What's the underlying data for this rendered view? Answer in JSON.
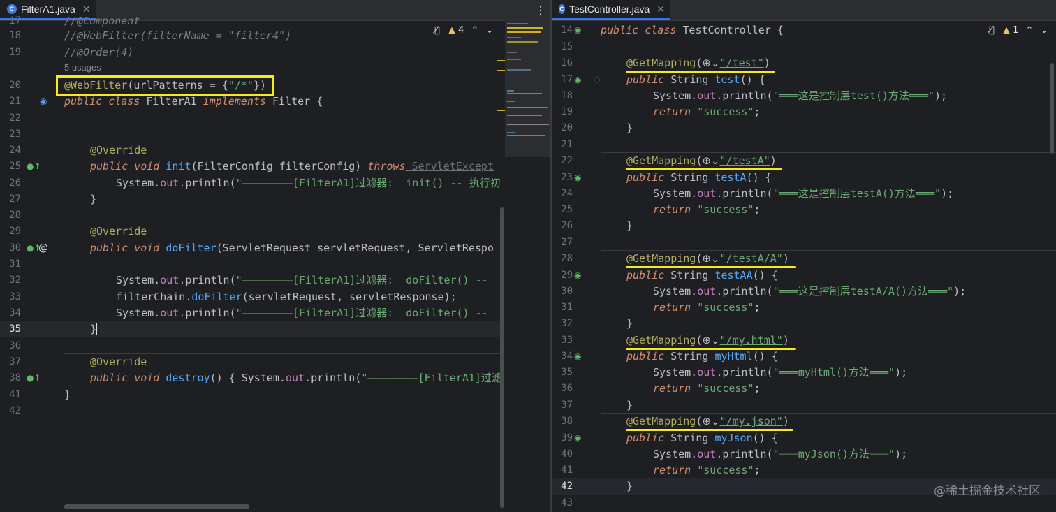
{
  "left": {
    "tab_label": "FilterA1.java",
    "inspection_count": "4",
    "lines": {
      "l17": {
        "num": "17",
        "text": "//@Component"
      },
      "l18": {
        "num": "18",
        "text": "//@WebFilter(filterName = \"filter4\")"
      },
      "l19": {
        "num": "19",
        "text": "//@Order(4)"
      },
      "usages": "5 usages",
      "l20": {
        "num": "20",
        "ann": "@WebFilter",
        "rest": "(urlPatterns = {",
        "str": "\"/*\"",
        "end": "})"
      },
      "l21": {
        "num": "21",
        "kw1": "public",
        "kw2": "class",
        "name": " FilterA1 ",
        "kw3": "implements",
        "rest": " Filter {"
      },
      "l22": {
        "num": "22"
      },
      "l23": {
        "num": "23"
      },
      "l24": {
        "num": "24",
        "ann": "@Override"
      },
      "l25": {
        "num": "25",
        "kw1": "public",
        "kw2": "void",
        "fn": "init",
        "rest": "(FilterConfig filterConfig) ",
        "kw3": "throws",
        "dep": " ServletExcept"
      },
      "l26": {
        "num": "26",
        "pre": "System.",
        "fld": "out",
        "mid": ".println(",
        "str": "\"————————[FilterA1]过滤器:  init() -- 执行初"
      },
      "l27": {
        "num": "27",
        "text": "}"
      },
      "l28": {
        "num": "28"
      },
      "l29": {
        "num": "29",
        "ann": "@Override"
      },
      "l30": {
        "num": "30",
        "kw1": "public",
        "kw2": "void",
        "fn": "doFilter",
        "rest": "(ServletRequest servletRequest, ServletRespo"
      },
      "l31": {
        "num": "31"
      },
      "l32": {
        "num": "32",
        "pre": "System.",
        "fld": "out",
        "mid": ".println(",
        "str": "\"————————[FilterA1]过滤器:  doFilter() --"
      },
      "l33": {
        "num": "33",
        "pre": "filterChain.",
        "fn": "doFilter",
        "rest": "(servletRequest, servletResponse);"
      },
      "l34": {
        "num": "34",
        "pre": "System.",
        "fld": "out",
        "mid": ".println(",
        "str": "\"————————[FilterA1]过滤器:  doFilter() --"
      },
      "l35": {
        "num": "35",
        "text": "}"
      },
      "l36": {
        "num": "36"
      },
      "l37": {
        "num": "37",
        "ann": "@Override"
      },
      "l38": {
        "num": "38",
        "kw1": "public",
        "kw2": "void",
        "fn": "destroy",
        "rest": "() { System.",
        "fld": "out",
        "mid": ".println(",
        "str": "\"————————[FilterA1]过滤"
      },
      "l41": {
        "num": "41",
        "text": "}"
      },
      "l42": {
        "num": "42"
      }
    }
  },
  "right": {
    "tab_label": "TestController.java",
    "inspection_count": "1",
    "watermark": "@稀土掘金技术社区",
    "lines": {
      "l14": {
        "num": "14",
        "kw1": "public",
        "kw2": "class",
        "rest": " TestController {"
      },
      "l15": {
        "num": "15"
      },
      "l16": {
        "num": "16",
        "ann": "@GetMapping",
        "open": "(",
        "path": "\"/test\"",
        "close": ")"
      },
      "l17": {
        "num": "17",
        "kw1": "public",
        "rest": " String ",
        "fn": "test",
        "end": "() {"
      },
      "l18": {
        "num": "18",
        "pre": "System.",
        "fld": "out",
        "mid": ".println(",
        "str": "\"═══这是控制层test()方法═══\"",
        "end": ");"
      },
      "l19": {
        "num": "19",
        "kw": "return",
        "str": " \"success\"",
        "end": ";"
      },
      "l20": {
        "num": "20",
        "text": "}"
      },
      "l21": {
        "num": "21"
      },
      "l22": {
        "num": "22",
        "ann": "@GetMapping",
        "open": "(",
        "path": "\"/testA\"",
        "close": ")"
      },
      "l23": {
        "num": "23",
        "kw1": "public",
        "rest": " String ",
        "fn": "testA",
        "end": "() {"
      },
      "l24": {
        "num": "24",
        "pre": "System.",
        "fld": "out",
        "mid": ".println(",
        "str": "\"═══这是控制层testA()方法═══\"",
        "end": ");"
      },
      "l25": {
        "num": "25",
        "kw": "return",
        "str": " \"success\"",
        "end": ";"
      },
      "l26": {
        "num": "26",
        "text": "}"
      },
      "l27": {
        "num": "27"
      },
      "l28": {
        "num": "28",
        "ann": "@GetMapping",
        "open": "(",
        "path": "\"/testA/A\"",
        "close": ")"
      },
      "l29": {
        "num": "29",
        "kw1": "public",
        "rest": " String ",
        "fn": "testAA",
        "end": "() {"
      },
      "l30": {
        "num": "30",
        "pre": "System.",
        "fld": "out",
        "mid": ".println(",
        "str": "\"═══这是控制层testA/A()方法═══\"",
        "end": ");"
      },
      "l31": {
        "num": "31",
        "kw": "return",
        "str": " \"success\"",
        "end": ";"
      },
      "l32": {
        "num": "32",
        "text": "}"
      },
      "l33": {
        "num": "33",
        "ann": "@GetMapping",
        "open": "(",
        "path": "\"/my.html\"",
        "close": ")"
      },
      "l34": {
        "num": "34",
        "kw1": "public",
        "rest": " String ",
        "fn": "myHtml",
        "end": "() {"
      },
      "l35": {
        "num": "35",
        "pre": "System.",
        "fld": "out",
        "mid": ".println(",
        "str": "\"═══myHtml()方法═══\"",
        "end": ");"
      },
      "l36": {
        "num": "36",
        "kw": "return",
        "str": " \"success\"",
        "end": ";"
      },
      "l37": {
        "num": "37",
        "text": "}"
      },
      "l38": {
        "num": "38",
        "ann": "@GetMapping",
        "open": "(",
        "path": "\"/my.json\"",
        "close": ")"
      },
      "l39": {
        "num": "39",
        "kw1": "public",
        "rest": " String ",
        "fn": "myJson",
        "end": "() {"
      },
      "l40": {
        "num": "40",
        "pre": "System.",
        "fld": "out",
        "mid": ".println(",
        "str": "\"═══myJson()方法═══\"",
        "end": ");"
      },
      "l41": {
        "num": "41",
        "kw": "return",
        "str": " \"success\"",
        "end": ";"
      },
      "l42": {
        "num": "42",
        "text": "}"
      },
      "l43": {
        "num": "43"
      }
    }
  },
  "colors": {
    "highlight": "#f7e91a",
    "keyword": "#cf8e6d",
    "annotation": "#b3ae60",
    "string": "#6aab73",
    "function": "#56a8f5",
    "field": "#c77dbb"
  }
}
